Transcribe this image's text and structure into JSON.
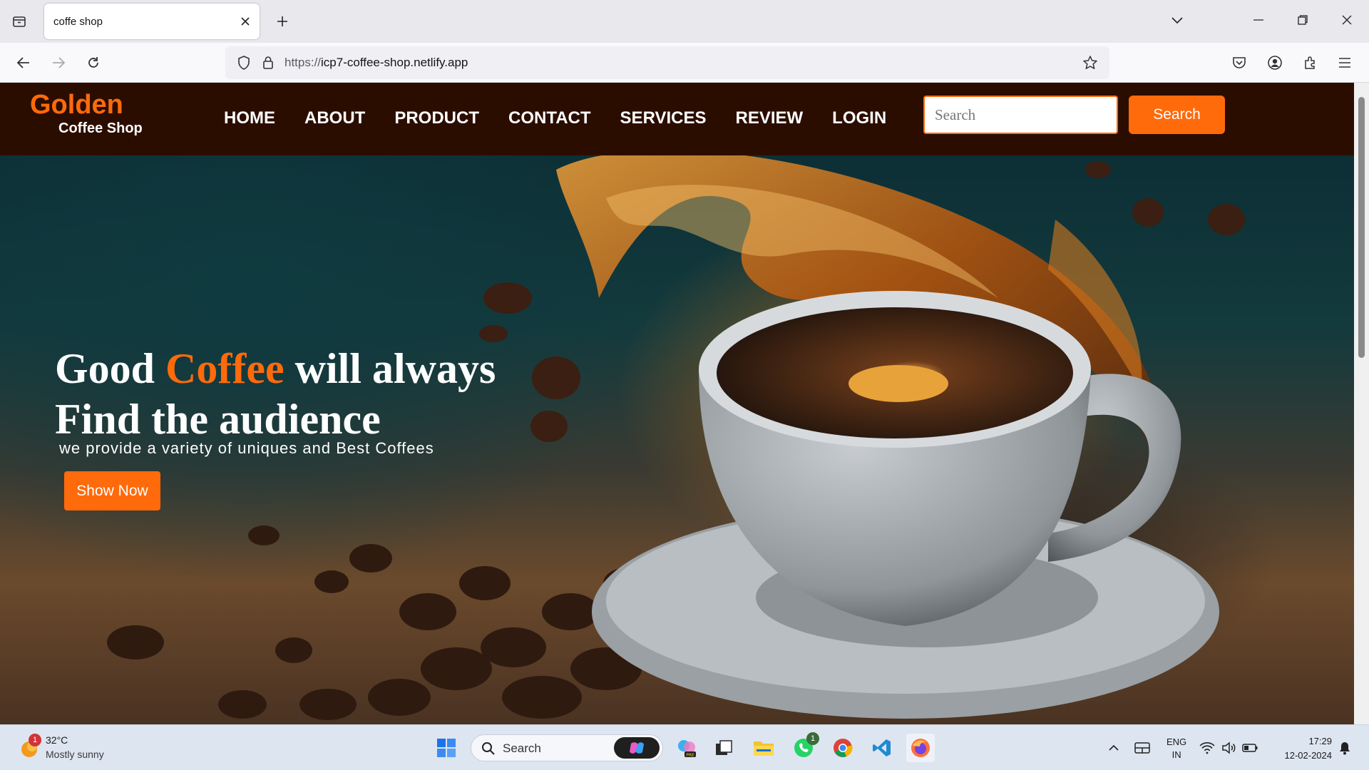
{
  "browser": {
    "tab_title": "coffe shop",
    "url_scheme": "https://",
    "url_host": "icp7-coffee-shop.netlify.app"
  },
  "site": {
    "brand": {
      "name": "Golden",
      "subtitle": "Coffee Shop"
    },
    "nav": [
      "HOME",
      "ABOUT",
      "PRODUCT",
      "CONTACT",
      "SERVICES",
      "REVIEW",
      "LOGIN"
    ],
    "search": {
      "placeholder": "Search",
      "button": "Search"
    },
    "hero": {
      "title_part1": "Good ",
      "title_accent": "Coffee",
      "title_part2": " will always",
      "title_line2": "Find the audience",
      "subtitle": "we provide a variety of uniques and Best Coffees",
      "cta": "Show Now"
    },
    "colors": {
      "accent": "#ff6a0b",
      "header_bg": "#2b0d00"
    }
  },
  "taskbar": {
    "weather": {
      "temp": "32°C",
      "condition": "Mostly sunny",
      "badge": "1"
    },
    "search_label": "Search",
    "whatsapp_badge": "1",
    "lang": {
      "line1": "ENG",
      "line2": "IN"
    },
    "time": "17:29",
    "date": "12-02-2024"
  }
}
